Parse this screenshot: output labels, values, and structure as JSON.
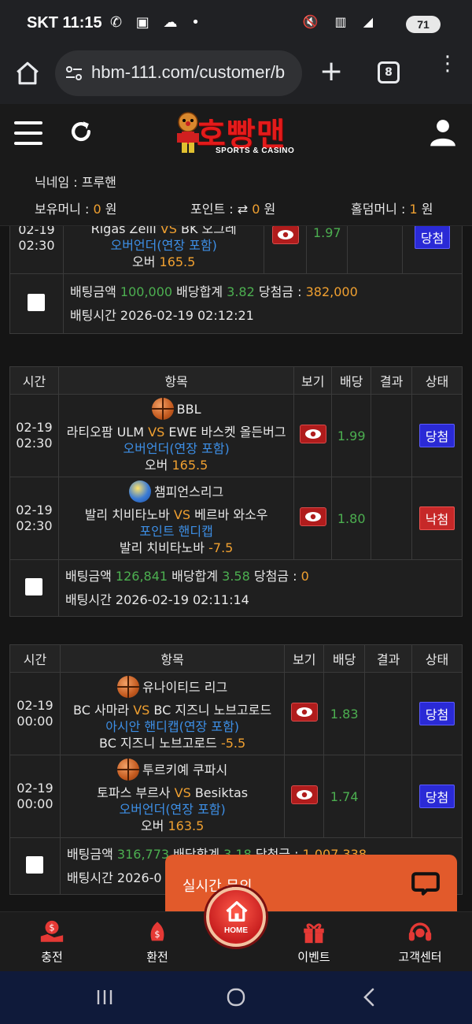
{
  "status_bar": {
    "carrier_time": "SKT 11:15",
    "battery": "71",
    "left_icons": [
      "phone-icon",
      "app-icon",
      "cloud-icon",
      "dot-icon"
    ],
    "right_icons": [
      "mute-icon",
      "5g-icon",
      "signal-icon"
    ]
  },
  "browser": {
    "url": "hbm-111.com/customer/b",
    "tab_count": "8"
  },
  "site": {
    "logo_text": "호빵맨",
    "logo_sub": "SPORTS & CASINO",
    "nickname_label": "닉네임 : 프루핸",
    "money": {
      "holding_label": "보유머니 : ",
      "holding_value": "0",
      "holding_unit": " 원",
      "point_label": "포인트 : ",
      "point_value": "0",
      "point_unit": " 원",
      "holdem_label": "홀덤머니 : ",
      "holdem_value": "1",
      "holdem_unit": " 원"
    }
  },
  "headers": {
    "time": "시간",
    "item": "항목",
    "view": "보기",
    "odds": "배당",
    "result": "결과",
    "state": "상태"
  },
  "labels": {
    "bet_amount": "배팅금액 ",
    "total_odds": " 배당합계 ",
    "win_amount": " 당첨금 : ",
    "bet_time": "배팅시간 "
  },
  "partial_bet": {
    "row": {
      "date": "02-19",
      "time": "02:30",
      "match_home": "Rigas Zelli",
      "vs": "VS",
      "match_away": "BK 오그레",
      "market": "오버언더(연장 포함)",
      "pick": "오버",
      "line": "165.5",
      "odds": "1.97",
      "state": "당첨"
    },
    "amount": "100,000",
    "total_odds": "3.82",
    "win": "382,000",
    "bet_time": "2026-02-19 02:12:21"
  },
  "bet2": {
    "rows": [
      {
        "date": "02-19",
        "time": "02:30",
        "league": "BBL",
        "league_icon": "basketball-icon",
        "match_home": "라티오팜 ULM",
        "vs": "VS",
        "match_away": "EWE 바스켓 올든버그",
        "market": "오버언더(연장 포함)",
        "pick": "오버",
        "line": "165.5",
        "odds": "1.99",
        "state": "당첨"
      },
      {
        "date": "02-19",
        "time": "02:30",
        "league": "챔피언스리그",
        "league_icon": "volleyball-icon",
        "match_home": "발리 치비타노바",
        "vs": "VS",
        "match_away": "베르바 와소우",
        "market": "포인트 핸디캡",
        "pick": "발리 치비타노바",
        "line": "-7.5",
        "odds": "1.80",
        "state": "낙첨"
      }
    ],
    "amount": "126,841",
    "total_odds": "3.58",
    "win": "0",
    "bet_time": "2026-02-19 02:11:14"
  },
  "bet3": {
    "rows": [
      {
        "date": "02-19",
        "time": "00:00",
        "league": "유나이티드 리그",
        "league_icon": "basketball-icon",
        "match_home": "BC 사마라",
        "vs": "VS",
        "match_away": "BC 지즈니 노브고로드",
        "market": "아시안 핸디캡(연장 포함)",
        "pick": "BC 지즈니 노브고로드",
        "line": "-5.5",
        "odds": "1.83",
        "state": "당첨"
      },
      {
        "date": "02-19",
        "time": "00:00",
        "league": "투르키예 쿠파시",
        "league_icon": "basketball-icon",
        "match_home": "토파스 부르사",
        "vs": "VS",
        "match_away": "Besiktas",
        "market": "오버언더(연장 포함)",
        "pick": "오버",
        "line": "163.5",
        "odds": "1.74",
        "state": "당첨"
      }
    ],
    "amount": "316,773",
    "total_odds": "3.18",
    "win": "1,007,338",
    "bet_time_partial": "2026-0"
  },
  "chat": {
    "label": "실시간 문의"
  },
  "bottom_nav": {
    "charge": "충전",
    "exchange": "환전",
    "home": "HOME",
    "event": "이벤트",
    "support": "고객센터"
  },
  "colors": {
    "win_badge": "#2a2ad6",
    "lose_badge": "#c62828",
    "odds": "#4caf50",
    "amount": "#f0a030",
    "market": "#3d8fe6",
    "chat": "#e25a2b",
    "logo": "#e31b1b"
  }
}
